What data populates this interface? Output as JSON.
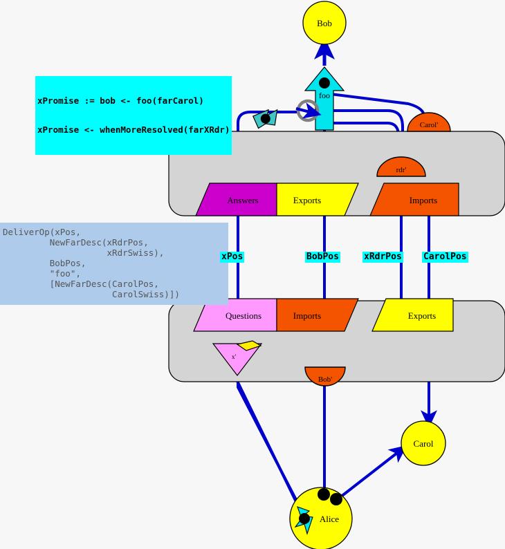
{
  "diagram": {
    "title": "E distributed promise pipelining / three-party handoff diagram",
    "colors": {
      "background": "#f7f7f7",
      "wire": "#0000cc",
      "vat_fill": "#d4d4d4",
      "vat_stroke": "#000000",
      "actor_fill": "#ffff00",
      "import_fill": "#f45400",
      "export_fill": "#ffff00",
      "answers_fill": "#cc00cc",
      "questions_fill": "#ff99ff",
      "highlight": "#00ffff",
      "deliver_fill": "#aecbeb",
      "deliver_text": "#555555",
      "ring_stroke": "#808080"
    },
    "code_block": {
      "line1": "xPromise := bob <- foo(farCarol)",
      "line2": "xPromise <- whenMoreResolved(farXRdr)"
    },
    "deliver_block": {
      "text": "DeliverOp(xPos,\n         NewFarDesc(xRdrPos,\n                    xRdrSwiss),\n         BobPos,\n         \"foo\",\n         [NewFarDesc(CarolPos,\n                     CarolSwiss)])"
    },
    "position_labels": [
      {
        "name": "xPos",
        "text": "xPos"
      },
      {
        "name": "BobPos",
        "text": "BobPos"
      },
      {
        "name": "xRdrPos",
        "text": "xRdrPos"
      },
      {
        "name": "CarolPos",
        "text": "CarolPos"
      }
    ],
    "actors": [
      {
        "id": "bob",
        "label": "Bob"
      },
      {
        "id": "carol",
        "label": "Carol"
      },
      {
        "id": "alice",
        "label": "Alice"
      }
    ],
    "message_arrow": {
      "label": "foo"
    },
    "top_vat": {
      "name": "top-vat",
      "tables": [
        {
          "id": "answers",
          "label": "Answers"
        },
        {
          "id": "exports",
          "label": "Exports"
        },
        {
          "id": "imports",
          "label": "Imports"
        }
      ],
      "domes": [
        {
          "id": "rdr-prime",
          "label": "rdr'"
        },
        {
          "id": "carol-prime",
          "label": "Carol'"
        }
      ]
    },
    "bottom_vat": {
      "name": "bottom-vat",
      "tables": [
        {
          "id": "questions",
          "label": "Questions"
        },
        {
          "id": "imports",
          "label": "Imports"
        },
        {
          "id": "exports",
          "label": "Exports"
        }
      ],
      "promise": {
        "id": "x-prime",
        "label": "x'"
      },
      "domes": [
        {
          "id": "bob-prime",
          "label": "Bob'"
        }
      ]
    }
  }
}
